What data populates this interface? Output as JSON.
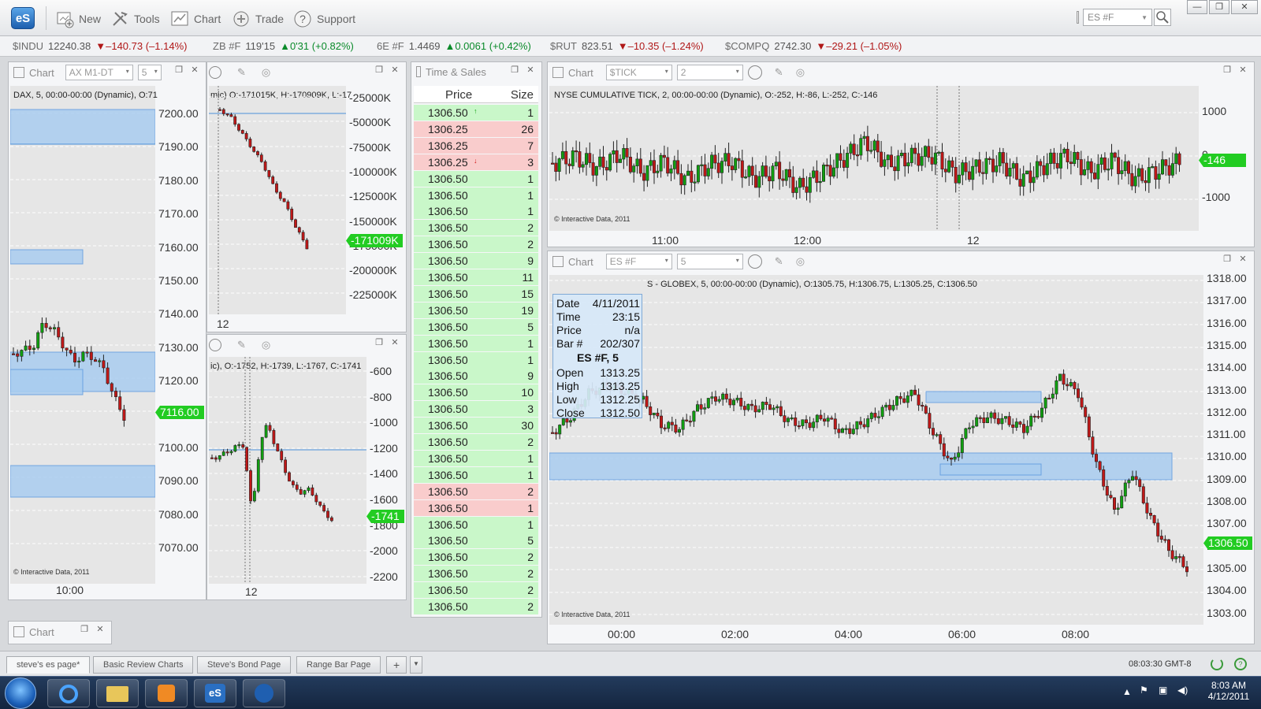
{
  "app": {
    "logo": "eS",
    "toolbar": [
      {
        "label": "New",
        "icon": "new-chart-icon"
      },
      {
        "label": "Tools",
        "icon": "tools-icon"
      },
      {
        "label": "Chart",
        "icon": "chart-icon"
      },
      {
        "label": "Trade",
        "icon": "trade-icon"
      },
      {
        "label": "Support",
        "icon": "support-icon"
      }
    ],
    "symbol_value": "ES #F"
  },
  "ticker": [
    {
      "sym": "$INDU",
      "px": "12240.38",
      "chg": "▼–140.73 (–1.14%)",
      "dir": "dn"
    },
    {
      "sym": "ZB #F",
      "px": "119'15",
      "chg": "▲0'31 (+0.82%)",
      "dir": "up"
    },
    {
      "sym": "6E #F",
      "px": "1.4469",
      "chg": "▲0.0061 (+0.42%)",
      "dir": "up"
    },
    {
      "sym": "$RUT",
      "px": "823.51",
      "chg": "▼–10.35 (–1.24%)",
      "dir": "dn"
    },
    {
      "sym": "$COMPQ",
      "px": "2742.30",
      "chg": "▼–29.21 (–1.05%)",
      "dir": "dn"
    }
  ],
  "dax": {
    "title": "Chart",
    "symbol": "AX M1-DT",
    "interval": "5",
    "info": "DAX, 5, 00:00-00:00 (Dynamic), O:71",
    "yticks": [
      "7200.00",
      "7190.00",
      "7180.00",
      "7170.00",
      "7160.00",
      "7150.00",
      "7140.00",
      "7130.00",
      "7120.00",
      "7110.00",
      "7100.00",
      "7090.00",
      "7080.00",
      "7070.00"
    ],
    "last": "7116.00",
    "copyright": "© Interactive Data, 2011",
    "time": "10:00"
  },
  "small1": {
    "info": "mic) O:-171015K, H:-170909K, L:-17",
    "yticks": [
      "-25000K",
      "-50000K",
      "-75000K",
      "-100000K",
      "-125000K",
      "-150000K",
      "-175000K",
      "-200000K",
      "-225000K"
    ],
    "last": "-171009K",
    "time": "12"
  },
  "small2": {
    "info": "ic), O:-1752, H:-1739, L:-1767, C:-1741",
    "yticks": [
      "-600",
      "-800",
      "-1000",
      "-1200",
      "-1400",
      "-1600",
      "-1800",
      "-2000",
      "-2200"
    ],
    "last": "-1741",
    "time": "12"
  },
  "ts": {
    "title": "Time & Sales",
    "col_price": "Price",
    "col_size": "Size",
    "rows": [
      {
        "p": "1306.50",
        "s": "1",
        "c": "g",
        "a": "up"
      },
      {
        "p": "1306.25",
        "s": "26",
        "c": "r"
      },
      {
        "p": "1306.25",
        "s": "7",
        "c": "r"
      },
      {
        "p": "1306.25",
        "s": "3",
        "c": "r",
        "a": "dn"
      },
      {
        "p": "1306.50",
        "s": "1",
        "c": "g"
      },
      {
        "p": "1306.50",
        "s": "1",
        "c": "g"
      },
      {
        "p": "1306.50",
        "s": "1",
        "c": "g"
      },
      {
        "p": "1306.50",
        "s": "2",
        "c": "g"
      },
      {
        "p": "1306.50",
        "s": "2",
        "c": "g"
      },
      {
        "p": "1306.50",
        "s": "9",
        "c": "g"
      },
      {
        "p": "1306.50",
        "s": "11",
        "c": "g"
      },
      {
        "p": "1306.50",
        "s": "15",
        "c": "g"
      },
      {
        "p": "1306.50",
        "s": "19",
        "c": "g"
      },
      {
        "p": "1306.50",
        "s": "5",
        "c": "g"
      },
      {
        "p": "1306.50",
        "s": "1",
        "c": "g"
      },
      {
        "p": "1306.50",
        "s": "1",
        "c": "g"
      },
      {
        "p": "1306.50",
        "s": "9",
        "c": "g"
      },
      {
        "p": "1306.50",
        "s": "10",
        "c": "g"
      },
      {
        "p": "1306.50",
        "s": "3",
        "c": "g"
      },
      {
        "p": "1306.50",
        "s": "30",
        "c": "g"
      },
      {
        "p": "1306.50",
        "s": "2",
        "c": "g"
      },
      {
        "p": "1306.50",
        "s": "1",
        "c": "g"
      },
      {
        "p": "1306.50",
        "s": "1",
        "c": "g"
      },
      {
        "p": "1306.50",
        "s": "2",
        "c": "r"
      },
      {
        "p": "1306.50",
        "s": "1",
        "c": "r"
      },
      {
        "p": "1306.50",
        "s": "1",
        "c": "g"
      },
      {
        "p": "1306.50",
        "s": "5",
        "c": "g"
      },
      {
        "p": "1306.50",
        "s": "2",
        "c": "g"
      },
      {
        "p": "1306.50",
        "s": "2",
        "c": "g"
      },
      {
        "p": "1306.50",
        "s": "2",
        "c": "g"
      },
      {
        "p": "1306.50",
        "s": "2",
        "c": "g"
      }
    ]
  },
  "tick": {
    "title": "Chart",
    "symbol": "$TICK",
    "interval": "2",
    "info": "NYSE CUMULATIVE TICK, 2, 00:00-00:00 (Dynamic), O:-252, H:-86, L:-252, C:-146",
    "yticks": [
      "1000",
      "0",
      "-1000"
    ],
    "last": "-146",
    "copyright": "© Interactive Data, 2011",
    "times": [
      "11:00",
      "12:00",
      "12"
    ]
  },
  "es": {
    "title": "Chart",
    "symbol": "ES #F",
    "interval": "5",
    "info": "S - GLOBEX, 5, 00:00-00:00 (Dynamic), O:1305.75, H:1306.75, L:1305.25, C:1306.50",
    "yticks": [
      "1318.00",
      "1317.00",
      "1316.00",
      "1315.00",
      "1314.00",
      "1313.00",
      "1312.00",
      "1311.00",
      "1310.00",
      "1309.00",
      "1308.00",
      "1307.00",
      "1306.00",
      "1305.00",
      "1304.00",
      "1303.00"
    ],
    "last": "1306.50",
    "copyright": "© Interactive Data, 2011",
    "times": [
      "00:00",
      "02:00",
      "04:00",
      "06:00",
      "08:00"
    ],
    "tooltip": {
      "date_l": "Date",
      "date_v": "4/11/2011",
      "time_l": "Time",
      "time_v": "23:15",
      "price_l": "Price",
      "price_v": "n/a",
      "bar_l": "Bar #",
      "bar_v": "202/307",
      "name": "ES #F, 5",
      "open_l": "Open",
      "open_v": "1313.25",
      "high_l": "High",
      "high_v": "1313.25",
      "low_l": "Low",
      "low_v": "1312.25",
      "close_l": "Close",
      "close_v": "1312.50"
    }
  },
  "mini_chart": {
    "title": "Chart"
  },
  "tabs": [
    "steve's es page*",
    "Basic Review Charts",
    "Steve's Bond Page",
    "Range Bar Page"
  ],
  "clock": "08:03:30 GMT-8",
  "tray": {
    "time": "8:03 AM",
    "date": "4/12/2011"
  },
  "colors": {
    "bull": "#10a010",
    "bear": "#c01818",
    "zone": "#a9cdf0",
    "ts_green": "#c9f7c9",
    "ts_red": "#f9cccc",
    "last_tag": "#22cc22"
  }
}
